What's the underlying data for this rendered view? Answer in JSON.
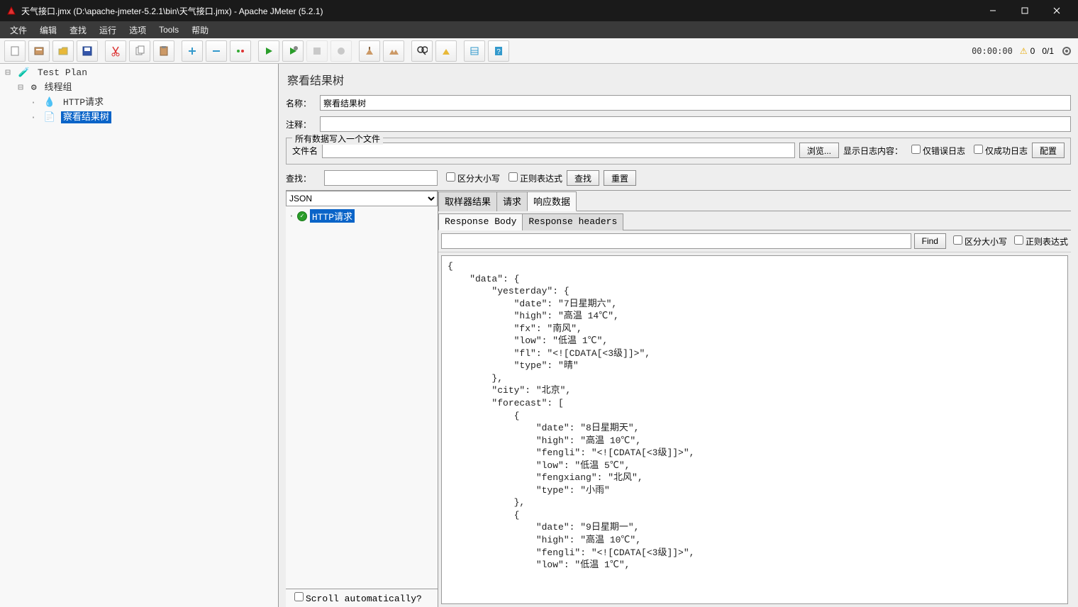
{
  "window": {
    "title": "天气接口.jmx (D:\\apache-jmeter-5.2.1\\bin\\天气接口.jmx) - Apache JMeter (5.2.1)"
  },
  "menu": {
    "file": "文件",
    "edit": "编辑",
    "search": "查找",
    "run": "运行",
    "options": "选项",
    "tools": "Tools",
    "help": "帮助"
  },
  "toolbar": {
    "timer": "00:00:00",
    "warn_count": "0",
    "run_count": "0/1"
  },
  "tree": {
    "root": "Test Plan",
    "thread_group": "线程组",
    "http_request": "HTTP请求",
    "view_results": "察看结果树"
  },
  "panel": {
    "title": "察看结果树",
    "name_label": "名称：",
    "name_value": "察看结果树",
    "comment_label": "注释：",
    "comment_value": "",
    "file_fieldset_legend": "所有数据写入一个文件",
    "filename_label": "文件名",
    "filename_value": "",
    "browse_btn": "浏览...",
    "show_log_label": "显示日志内容：",
    "only_error_label": "仅错误日志",
    "only_success_label": "仅成功日志",
    "configure_btn": "配置",
    "search_label": "查找：",
    "search_value": "",
    "case_sensitive": "区分大小写",
    "regex": "正则表达式",
    "search_btn": "查找",
    "reset_btn": "重置"
  },
  "results": {
    "renderer": "JSON",
    "item1": "HTTP请求",
    "scroll_auto": "Scroll automatically?"
  },
  "detail": {
    "tab_sampler": "取样器结果",
    "tab_request": "请求",
    "tab_response": "响应数据",
    "subtab_body": "Response Body",
    "subtab_headers": "Response headers",
    "find_btn": "Find",
    "find_case": "区分大小写",
    "find_regex": "正则表达式",
    "body": "{\n    \"data\": {\n        \"yesterday\": {\n            \"date\": \"7日星期六\",\n            \"high\": \"高温 14℃\",\n            \"fx\": \"南风\",\n            \"low\": \"低温 1℃\",\n            \"fl\": \"<![CDATA[<3级]]>\",\n            \"type\": \"晴\"\n        },\n        \"city\": \"北京\",\n        \"forecast\": [\n            {\n                \"date\": \"8日星期天\",\n                \"high\": \"高温 10℃\",\n                \"fengli\": \"<![CDATA[<3级]]>\",\n                \"low\": \"低温 5℃\",\n                \"fengxiang\": \"北风\",\n                \"type\": \"小雨\"\n            },\n            {\n                \"date\": \"9日星期一\",\n                \"high\": \"高温 10℃\",\n                \"fengli\": \"<![CDATA[<3级]]>\",\n                \"low\": \"低温 1℃\","
  }
}
